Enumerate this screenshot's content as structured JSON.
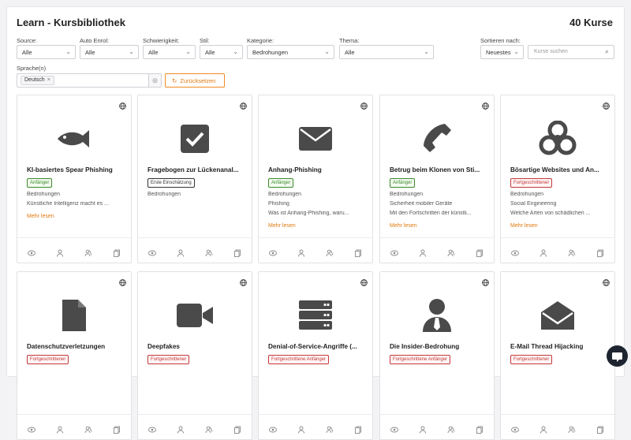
{
  "header": {
    "title": "Learn - Kursbibliothek",
    "count": "40 Kurse"
  },
  "filters": {
    "source": {
      "label": "Source:",
      "value": "Alle"
    },
    "auto_enrol": {
      "label": "Auto Enrol:",
      "value": "Alle"
    },
    "difficulty": {
      "label": "Schwierigkeit:",
      "value": "Alle"
    },
    "style": {
      "label": "Stil:",
      "value": "Alle"
    },
    "category": {
      "label": "Kategorie:",
      "value": "Bedrohungen"
    },
    "theme": {
      "label": "Thema:",
      "value": "Alle"
    },
    "sort": {
      "label": "Sortieren nach:",
      "value": "Neuestes"
    },
    "search": {
      "placeholder": "Kurse suchen"
    },
    "language": {
      "label": "Sprache(n)",
      "tag": "Deutsch"
    },
    "reset_label": "Zurücksetzen"
  },
  "colors": {
    "accent": "#e07a10",
    "icon": "#4a4a4a"
  },
  "cards": [
    {
      "title": "KI-basiertes Spear Phishing",
      "badge": "Anfänger",
      "badge_style": "green",
      "icon": "fish-icon",
      "meta": [
        "Bedrohungen",
        "Künstliche Intelligenz macht es ..."
      ],
      "more": "Mehr lesen"
    },
    {
      "title": "Fragebogen zur Lückenanal...",
      "badge": "Erste Einschätzung",
      "badge_style": "gray",
      "icon": "checkbox-icon",
      "meta": [
        "Bedrohungen"
      ],
      "more": ""
    },
    {
      "title": "Anhang-Phishing",
      "badge": "Anfänger",
      "badge_style": "green",
      "icon": "envelope-icon",
      "meta": [
        "Bedrohungen",
        "Phishing",
        "Was ist Anhang-Phishing, waru..."
      ],
      "more": "Mehr lesen"
    },
    {
      "title": "Betrug beim Klonen von Sti...",
      "badge": "Anfänger",
      "badge_style": "green",
      "icon": "phone-icon",
      "meta": [
        "Bedrohungen",
        "Sicherheit mobiler Geräte",
        "Mit den Fortschritten der künstli..."
      ],
      "more": "Mehr lesen"
    },
    {
      "title": "Bösartige Websites und An...",
      "badge": "Fortgeschrittener",
      "badge_style": "red",
      "icon": "biohazard-icon",
      "meta": [
        "Bedrohungen",
        "Social Engineering",
        "Welche Arten von schädlichen ..."
      ],
      "more": "Mehr lesen"
    },
    {
      "title": "Datenschutzverletzungen",
      "badge": "Fortgeschrittener",
      "badge_style": "red",
      "icon": "file-icon",
      "meta": [],
      "more": ""
    },
    {
      "title": "Deepfakes",
      "badge": "Fortgeschrittener",
      "badge_style": "red",
      "icon": "video-icon",
      "meta": [],
      "more": ""
    },
    {
      "title": "Denial-of-Service-Angriffe (...",
      "badge": "Fortgeschrittene Anfänger",
      "badge_style": "red",
      "icon": "server-icon",
      "meta": [],
      "more": ""
    },
    {
      "title": "Die Insider-Bedrohung",
      "badge": "Fortgeschrittene Anfänger",
      "badge_style": "red",
      "icon": "user-tie-icon",
      "meta": [],
      "more": ""
    },
    {
      "title": "E-Mail Thread Hijacking",
      "badge": "Fortgeschrittener",
      "badge_style": "red",
      "icon": "envelope-open-icon",
      "meta": [],
      "more": ""
    }
  ]
}
